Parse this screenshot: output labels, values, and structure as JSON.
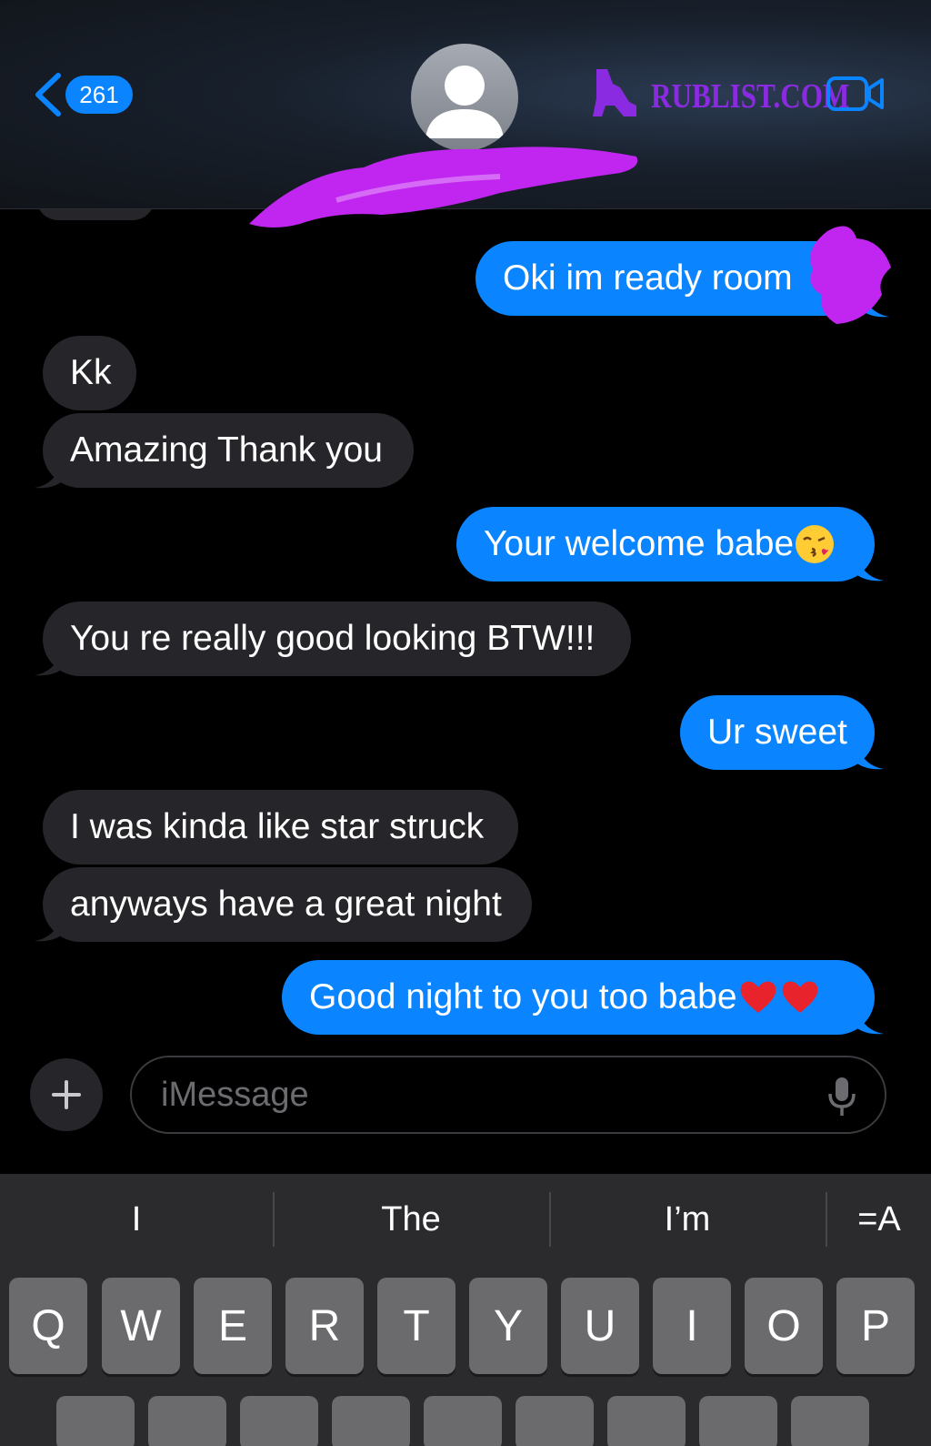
{
  "header": {
    "back_count": "261",
    "watermark": "RUBLIST.COM"
  },
  "messages": [
    {
      "dir": "sent",
      "text": "Oki im ready room"
    },
    {
      "dir": "recv",
      "text": "Kk"
    },
    {
      "dir": "recv",
      "text": "Amazing Thank you"
    },
    {
      "dir": "sent",
      "text": "Your welcome babe",
      "emoji": [
        "kissing-face"
      ]
    },
    {
      "dir": "recv",
      "text": "You re really good looking BTW!!!"
    },
    {
      "dir": "sent",
      "text": "Ur sweet"
    },
    {
      "dir": "recv",
      "text": "I was kinda like star struck"
    },
    {
      "dir": "recv",
      "text": "anyways have a great night"
    },
    {
      "dir": "sent",
      "text": "Good night to you too babe",
      "emoji": [
        "red-heart",
        "red-heart"
      ]
    }
  ],
  "input": {
    "placeholder": "iMessage"
  },
  "keyboard": {
    "suggestions": [
      "I",
      "The",
      "I’m"
    ],
    "format_label": "=A",
    "row1": [
      "Q",
      "W",
      "E",
      "R",
      "T",
      "Y",
      "U",
      "I",
      "O",
      "P"
    ]
  },
  "colors": {
    "sent_bubble": "#0a84ff",
    "received_bubble": "#26252a",
    "watermark": "#8a2be2",
    "redaction": "#c026f0"
  }
}
